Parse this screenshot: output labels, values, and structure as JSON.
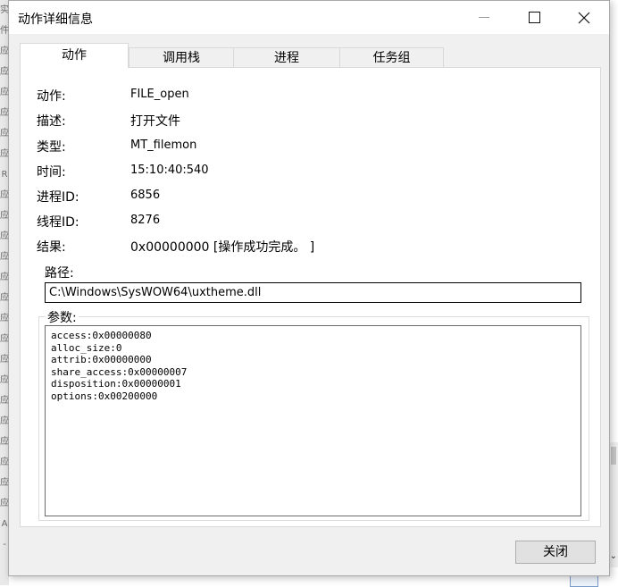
{
  "window": {
    "title": "动作详细信息",
    "controls": {
      "minimize": "minimize",
      "maximize": "maximize",
      "close": "close"
    }
  },
  "tabs": [
    {
      "label": "动作",
      "active": true
    },
    {
      "label": "调用栈",
      "active": false
    },
    {
      "label": "进程",
      "active": false
    },
    {
      "label": "任务组",
      "active": false
    }
  ],
  "details": [
    {
      "label": "动作:",
      "value": "FILE_open"
    },
    {
      "label": "描述:",
      "value": "打开文件"
    },
    {
      "label": "类型:",
      "value": "MT_filemon"
    },
    {
      "label": "时间:",
      "value": "15:10:40:540"
    },
    {
      "label": "进程ID:",
      "value": "6856"
    },
    {
      "label": "线程ID:",
      "value": "8276"
    },
    {
      "label": "结果:",
      "value": "0x00000000 [操作成功完成。 ]"
    }
  ],
  "path": {
    "label": "路径:",
    "value": "C:\\Windows\\SysWOW64\\uxtheme.dll"
  },
  "params": {
    "label": "参数:",
    "lines": [
      "access:0x00000080",
      "alloc_size:0",
      "attrib:0x00000000",
      "share_access:0x00000007",
      "disposition:0x00000001",
      "options:0x00200000"
    ]
  },
  "buttons": {
    "close": "关闭"
  },
  "background": {
    "left_glyphs": [
      "实",
      "件",
      "应",
      "应",
      "应",
      "应",
      "应",
      "应",
      "R",
      "应",
      "应",
      "应",
      "应",
      "应",
      "应",
      "应",
      "应",
      "应",
      "应",
      "应",
      "应",
      "应",
      "应",
      "应",
      "应",
      "A",
      "-"
    ]
  }
}
